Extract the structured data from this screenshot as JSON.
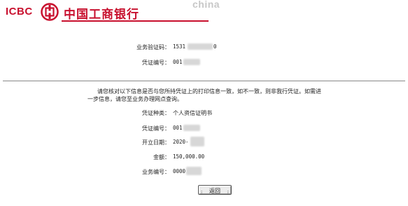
{
  "header": {
    "logo_text": "ICBC",
    "bank_name": "中国工商银行",
    "watermark": "china",
    "brand_color": "#c8102e"
  },
  "top_section": {
    "verification_code": {
      "label": "业务验证码：",
      "value": "1531",
      "suffix": "0"
    },
    "voucher_no": {
      "label": "凭证编号：",
      "value": "001"
    }
  },
  "notice": {
    "line1": "请您核对以下信息是否与您所持凭证上的打印信息一致，如不一致，则非我行凭证。如需进",
    "line2": "一步信息，请您至业务办理网点查询。"
  },
  "details": {
    "voucher_type": {
      "label": "凭证种类：",
      "value": "个人资信证明书"
    },
    "voucher_no": {
      "label": "凭证编号：",
      "value": "001"
    },
    "issue_date": {
      "label": "开立日期：",
      "value": "2020-"
    },
    "amount": {
      "label": "金额：",
      "value": "150,000.00"
    },
    "business_no": {
      "label": "业务编号：",
      "value": "0000"
    }
  },
  "back_button": {
    "label": "返回"
  }
}
